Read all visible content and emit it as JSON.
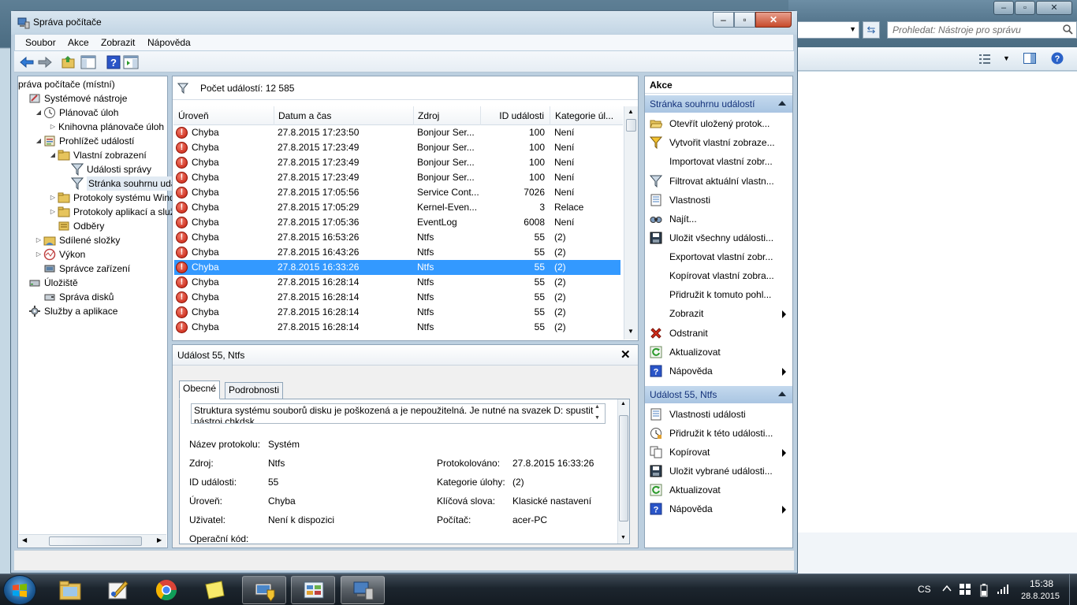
{
  "window": {
    "title": "Správa počítače"
  },
  "background_window": {
    "search_placeholder": "Prohledat: Nástroje pro správu"
  },
  "menu": [
    "Soubor",
    "Akce",
    "Zobrazit",
    "Nápověda"
  ],
  "tree": [
    {
      "label": "práva počítače (místní)",
      "level": 0,
      "arrow": "",
      "icon": "computer-management-icon"
    },
    {
      "label": "Systémové nástroje",
      "level": 1,
      "arrow": "",
      "icon": "system-tools-icon"
    },
    {
      "label": "Plánovač úloh",
      "level": 2,
      "arrow": "expanded",
      "icon": "task-scheduler-icon"
    },
    {
      "label": "Knihovna plánovače úloh",
      "level": 3,
      "arrow": "collapsed",
      "icon": ""
    },
    {
      "label": "Prohlížeč událostí",
      "level": 2,
      "arrow": "expanded",
      "icon": "event-viewer-icon"
    },
    {
      "label": "Vlastní zobrazení",
      "level": 3,
      "arrow": "expanded",
      "icon": "folder-icon"
    },
    {
      "label": "Události správy",
      "level": 4,
      "arrow": "",
      "icon": "filter-icon"
    },
    {
      "label": "Stránka souhrnu událostí",
      "level": 4,
      "arrow": "",
      "icon": "filter-icon",
      "selected": true
    },
    {
      "label": "Protokoly systému Windows",
      "level": 3,
      "arrow": "collapsed",
      "icon": "folder-icon"
    },
    {
      "label": "Protokoly aplikací a služeb",
      "level": 3,
      "arrow": "collapsed",
      "icon": "folder-icon"
    },
    {
      "label": "Odběry",
      "level": 3,
      "arrow": "",
      "icon": "subscriptions-icon"
    },
    {
      "label": "Sdílené složky",
      "level": 2,
      "arrow": "collapsed",
      "icon": "shared-folders-icon"
    },
    {
      "label": "Výkon",
      "level": 2,
      "arrow": "collapsed",
      "icon": "performance-icon"
    },
    {
      "label": "Správce zařízení",
      "level": 2,
      "arrow": "",
      "icon": "device-manager-icon"
    },
    {
      "label": "Úložiště",
      "level": 1,
      "arrow": "",
      "icon": "storage-icon"
    },
    {
      "label": "Správa disků",
      "level": 2,
      "arrow": "",
      "icon": "disk-management-icon"
    },
    {
      "label": "Služby a aplikace",
      "level": 1,
      "arrow": "",
      "icon": "services-icon"
    }
  ],
  "events": {
    "count_label": "Počet událostí: 12 585",
    "columns": [
      "Úroveň",
      "Datum a čas",
      "Zdroj",
      "ID události",
      "Kategorie úl..."
    ],
    "rows": [
      [
        "Chyba",
        "27.8.2015 17:23:50",
        "Bonjour Ser...",
        "100",
        "Není"
      ],
      [
        "Chyba",
        "27.8.2015 17:23:49",
        "Bonjour Ser...",
        "100",
        "Není"
      ],
      [
        "Chyba",
        "27.8.2015 17:23:49",
        "Bonjour Ser...",
        "100",
        "Není"
      ],
      [
        "Chyba",
        "27.8.2015 17:23:49",
        "Bonjour Ser...",
        "100",
        "Není"
      ],
      [
        "Chyba",
        "27.8.2015 17:05:56",
        "Service Cont...",
        "7026",
        "Není"
      ],
      [
        "Chyba",
        "27.8.2015 17:05:29",
        "Kernel-Even...",
        "3",
        "Relace"
      ],
      [
        "Chyba",
        "27.8.2015 17:05:36",
        "EventLog",
        "6008",
        "Není"
      ],
      [
        "Chyba",
        "27.8.2015 16:53:26",
        "Ntfs",
        "55",
        "(2)"
      ],
      [
        "Chyba",
        "27.8.2015 16:43:26",
        "Ntfs",
        "55",
        "(2)"
      ],
      [
        "Chyba",
        "27.8.2015 16:33:26",
        "Ntfs",
        "55",
        "(2)"
      ],
      [
        "Chyba",
        "27.8.2015 16:28:14",
        "Ntfs",
        "55",
        "(2)"
      ],
      [
        "Chyba",
        "27.8.2015 16:28:14",
        "Ntfs",
        "55",
        "(2)"
      ],
      [
        "Chyba",
        "27.8.2015 16:28:14",
        "Ntfs",
        "55",
        "(2)"
      ],
      [
        "Chyba",
        "27.8.2015 16:28:14",
        "Ntfs",
        "55",
        "(2)"
      ]
    ],
    "selected_index": 9
  },
  "detail": {
    "title": "Událost 55, Ntfs",
    "tabs": [
      "Obecné",
      "Podrobnosti"
    ],
    "description": "Struktura systému souborů disku je poškozená a je nepoužitelná. Je nutné na svazek D: spustit nástroj chkdsk.",
    "fields_left": [
      {
        "label": "Název protokolu:",
        "value": "Systém"
      },
      {
        "label": "Zdroj:",
        "value": "Ntfs"
      },
      {
        "label": "ID události:",
        "value": "55"
      },
      {
        "label": "Úroveň:",
        "value": "Chyba"
      },
      {
        "label": "Uživatel:",
        "value": "Není k dispozici"
      },
      {
        "label": "Operační kód:",
        "value": ""
      }
    ],
    "fields_right": [
      {
        "label": "Protokolováno:",
        "value": "27.8.2015 16:33:26"
      },
      {
        "label": "Kategorie úlohy:",
        "value": "(2)"
      },
      {
        "label": "Klíčová slova:",
        "value": "Klasické nastavení"
      },
      {
        "label": "Počítač:",
        "value": "acer-PC"
      }
    ]
  },
  "actions": {
    "title": "Akce",
    "section1": {
      "title": "Stránka souhrnu událostí",
      "items": [
        {
          "label": "Otevřít uložený protok...",
          "icon": "open-folder-icon",
          "submenu": false
        },
        {
          "label": "Vytvořit vlastní zobraze...",
          "icon": "create-view-icon",
          "submenu": false
        },
        {
          "label": "Importovat vlastní zobr...",
          "icon": "",
          "submenu": false
        },
        {
          "label": "Filtrovat aktuální vlastn...",
          "icon": "filter-icon",
          "submenu": false
        },
        {
          "label": "Vlastnosti",
          "icon": "properties-icon",
          "submenu": false
        },
        {
          "label": "Najít...",
          "icon": "find-icon",
          "submenu": false
        },
        {
          "label": "Uložit všechny události...",
          "icon": "save-icon",
          "submenu": false
        },
        {
          "label": "Exportovat vlastní zobr...",
          "icon": "",
          "submenu": false
        },
        {
          "label": "Kopírovat vlastní zobra...",
          "icon": "",
          "submenu": false
        },
        {
          "label": "Přidružit k tomuto pohl...",
          "icon": "",
          "submenu": false
        },
        {
          "label": "Zobrazit",
          "icon": "",
          "submenu": true
        },
        {
          "label": "Odstranit",
          "icon": "delete-icon",
          "submenu": false
        },
        {
          "label": "Aktualizovat",
          "icon": "refresh-icon",
          "submenu": false
        },
        {
          "label": "Nápověda",
          "icon": "help-icon",
          "submenu": true
        }
      ]
    },
    "section2": {
      "title": "Událost 55, Ntfs",
      "items": [
        {
          "label": "Vlastnosti události",
          "icon": "properties-icon",
          "submenu": false
        },
        {
          "label": "Přidružit k této události...",
          "icon": "attach-task-icon",
          "submenu": false
        },
        {
          "label": "Kopírovat",
          "icon": "copy-icon",
          "submenu": true
        },
        {
          "label": "Uložit vybrané události...",
          "icon": "save-icon",
          "submenu": false
        },
        {
          "label": "Aktualizovat",
          "icon": "refresh-icon",
          "submenu": false
        },
        {
          "label": "Nápověda",
          "icon": "help-icon",
          "submenu": true
        }
      ]
    }
  },
  "taskbar": {
    "language": "CS",
    "time": "15:38",
    "date": "28.8.2015"
  }
}
